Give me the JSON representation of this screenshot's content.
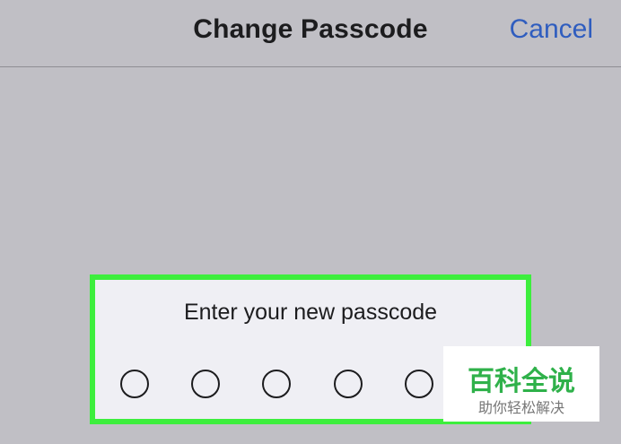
{
  "nav": {
    "title": "Change Passcode",
    "cancel_label": "Cancel"
  },
  "passcode": {
    "prompt": "Enter your new passcode",
    "digits_entered": 0,
    "visible_digit_slots": 6
  },
  "watermark": {
    "title": "百科全说",
    "subtitle": "助你轻松解决"
  },
  "colors": {
    "background": "#c0bfc5",
    "panel": "#efeff4",
    "highlight_border": "#3dee3d",
    "cancel_text": "#2f5dbf",
    "watermark_green": "#2fb14a"
  }
}
